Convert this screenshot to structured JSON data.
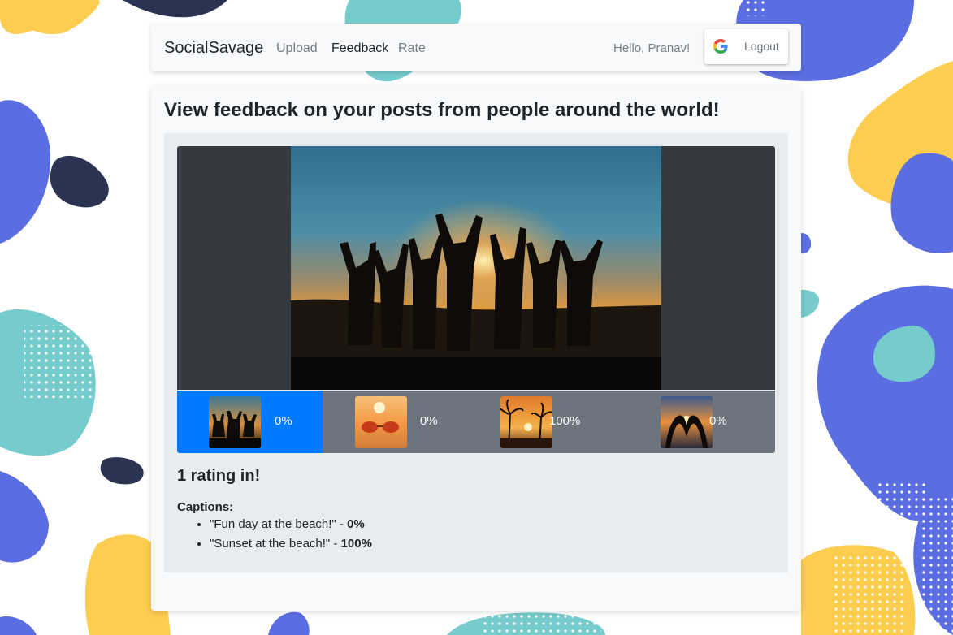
{
  "nav": {
    "brand": "SocialSavage",
    "links": [
      {
        "label": "Upload",
        "active": false
      },
      {
        "label": "Feedback",
        "active": true
      },
      {
        "label": "Rate",
        "active": false
      }
    ],
    "greeting": "Hello, Pranav!",
    "logout_label": "Logout",
    "logout_icon": "google-g-icon"
  },
  "main": {
    "title": "View feedback on your posts from people around the world!",
    "selected_index": 0,
    "thumbnails": [
      {
        "percent": "0%",
        "image": "group-silhouette-sunset"
      },
      {
        "percent": "0%",
        "image": "sunglasses-on-beach"
      },
      {
        "percent": "100%",
        "image": "palm-trees-sunset"
      },
      {
        "percent": "0%",
        "image": "heart-hands-sunset"
      }
    ],
    "rating_count": "1 rating in!",
    "captions_label": "Captions:",
    "captions": [
      {
        "text": "\"Fun day at the beach!\"",
        "separator": " - ",
        "percent": "0%"
      },
      {
        "text": "\"Sunset at the beach!\"",
        "separator": " - ",
        "percent": "100%"
      }
    ]
  },
  "colors": {
    "selected": "#007bff",
    "strip": "#6c757d",
    "viewer_bg": "#343a40",
    "blob_blue": "#5b6ee1",
    "blob_teal": "#76cccc",
    "blob_yellow": "#fdcd50",
    "blob_navy": "#2a3352"
  }
}
